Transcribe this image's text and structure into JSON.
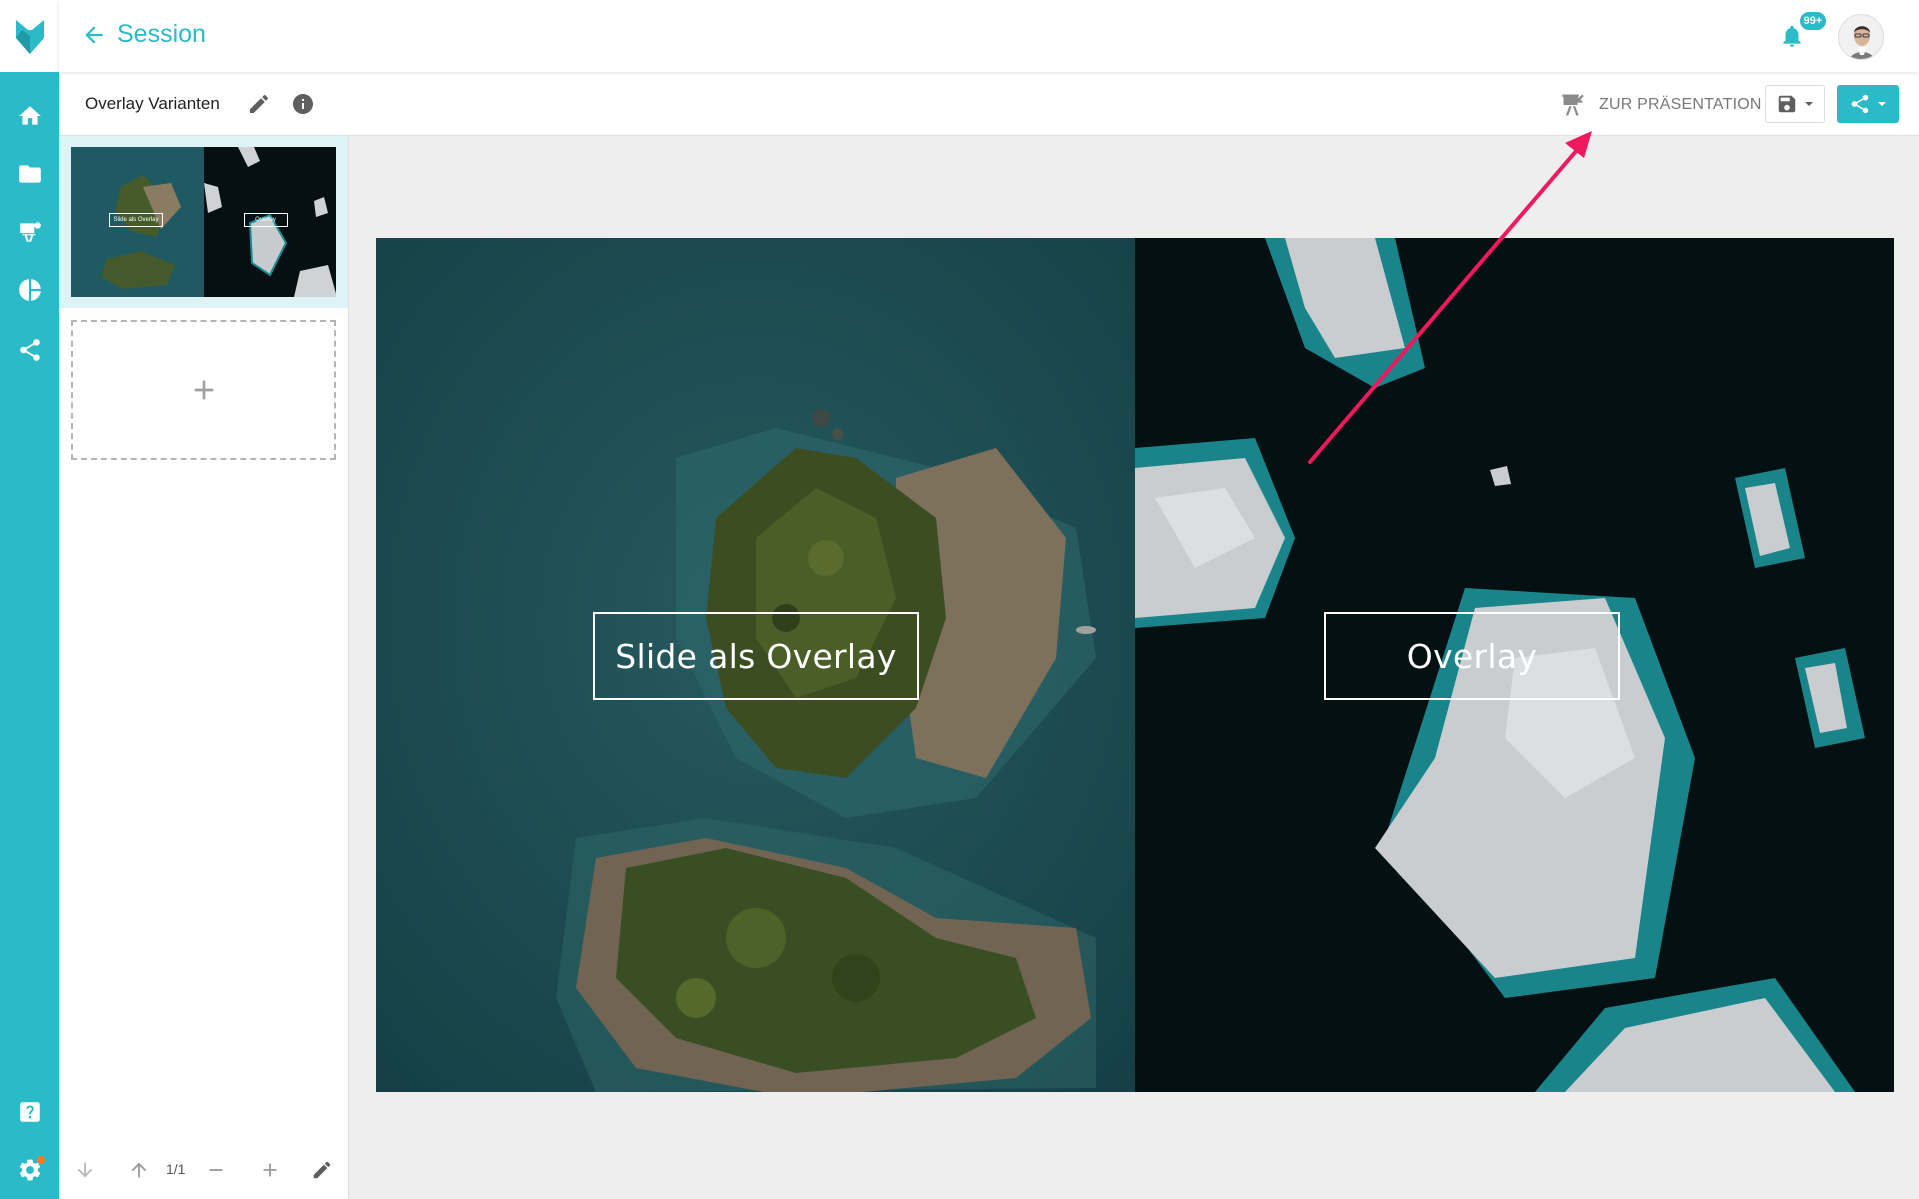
{
  "header": {
    "back_label": "Session",
    "notification_badge": "99+"
  },
  "toolbar": {
    "title": "Overlay Varianten",
    "present_label": "ZUR PRÄSENTATION"
  },
  "sidebar": {
    "items": [
      {
        "icon": "home-icon"
      },
      {
        "icon": "folder-icon"
      },
      {
        "icon": "presenter-icon"
      },
      {
        "icon": "pie-chart-icon"
      },
      {
        "icon": "share-icon"
      },
      {
        "icon": "help-icon"
      },
      {
        "icon": "gear-icon"
      }
    ]
  },
  "slides_panel": {
    "thumbnail_labels": [
      "Slide als Overlay",
      "Overlay"
    ],
    "page_indicator": "1/1"
  },
  "slide": {
    "left_label": "Slide als Overlay",
    "right_label": "Overlay"
  },
  "colors": {
    "accent": "#2bbac8",
    "annotation_arrow": "#f0195f"
  }
}
